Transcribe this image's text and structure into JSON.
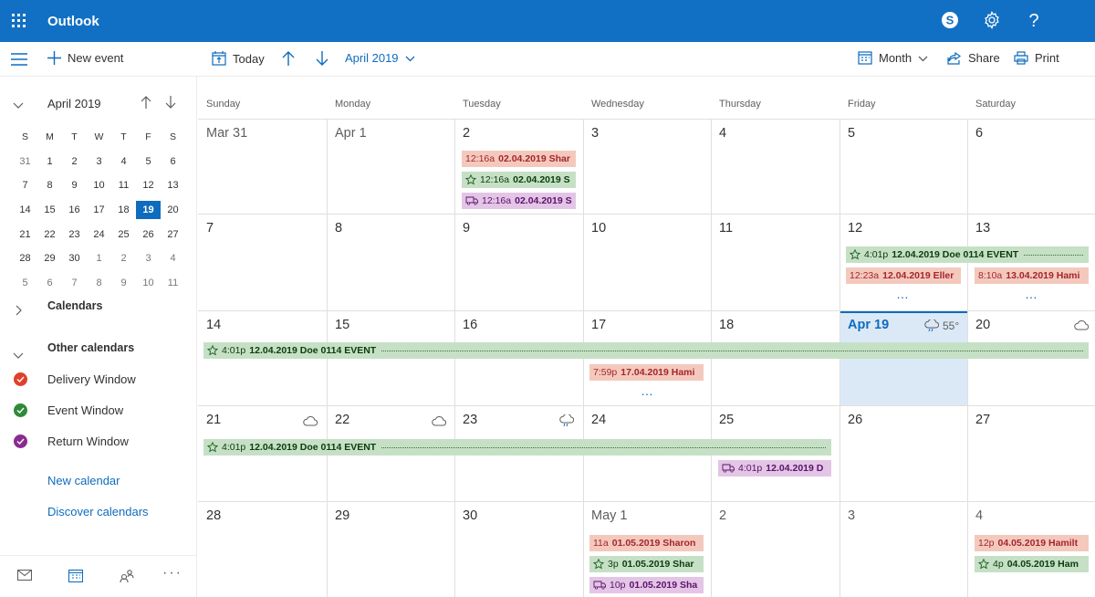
{
  "app": {
    "title": "Outlook"
  },
  "toolbar": {
    "new_event": "New event",
    "today": "Today",
    "month_label": "April 2019",
    "view": "Month",
    "share": "Share",
    "print": "Print"
  },
  "mini_calendar": {
    "title": "April 2019",
    "weekday_headers": [
      "S",
      "M",
      "T",
      "W",
      "T",
      "F",
      "S"
    ],
    "weeks": [
      [
        "31",
        "1",
        "2",
        "3",
        "4",
        "5",
        "6"
      ],
      [
        "7",
        "8",
        "9",
        "10",
        "11",
        "12",
        "13"
      ],
      [
        "14",
        "15",
        "16",
        "17",
        "18",
        "19",
        "20"
      ],
      [
        "21",
        "22",
        "23",
        "24",
        "25",
        "26",
        "27"
      ],
      [
        "28",
        "29",
        "30",
        "1",
        "2",
        "3",
        "4"
      ],
      [
        "5",
        "6",
        "7",
        "8",
        "9",
        "10",
        "11"
      ]
    ],
    "selected": "19"
  },
  "sidebar": {
    "calendars_label": "Calendars",
    "other_calendars_label": "Other calendars",
    "calendars": [
      {
        "name": "Delivery Window",
        "color": "#e0402a"
      },
      {
        "name": "Event Window",
        "color": "#2f8a3a"
      },
      {
        "name": "Return Window",
        "color": "#8a2c8f"
      }
    ],
    "new_calendar": "New calendar",
    "discover_calendars": "Discover calendars"
  },
  "calendar": {
    "weekdays": [
      "Sunday",
      "Monday",
      "Tuesday",
      "Wednesday",
      "Thursday",
      "Friday",
      "Saturday"
    ],
    "weeks": [
      [
        "Mar 31",
        "Apr 1",
        "2",
        "3",
        "4",
        "5",
        "6"
      ],
      [
        "7",
        "8",
        "9",
        "10",
        "11",
        "12",
        "13"
      ],
      [
        "14",
        "15",
        "16",
        "17",
        "18",
        "Apr 19",
        "20"
      ],
      [
        "21",
        "22",
        "23",
        "24",
        "25",
        "26",
        "27"
      ],
      [
        "28",
        "29",
        "30",
        "May 1",
        "2",
        "3",
        "4"
      ]
    ],
    "weather_today": "55°",
    "more": "…",
    "events": {
      "w0_tue_1": {
        "time": "12:16a",
        "title": "02.04.2019 Shar"
      },
      "w0_tue_2": {
        "time": "12:16a",
        "title": "02.04.2019 S"
      },
      "w0_tue_3": {
        "time": "12:16a",
        "title": "02.04.2019 S"
      },
      "w1_event": {
        "time": "4:01p",
        "title": "12.04.2019 Doe 0114 EVENT"
      },
      "w1_fri": {
        "time": "12:23a",
        "title": "12.04.2019 Eller"
      },
      "w1_sat": {
        "time": "8:10a",
        "title": "13.04.2019 Hami"
      },
      "w2_event": {
        "time": "4:01p",
        "title": "12.04.2019 Doe 0114 EVENT"
      },
      "w2_wed": {
        "time": "7:59p",
        "title": "17.04.2019 Hami"
      },
      "w3_event": {
        "time": "4:01p",
        "title": "12.04.2019 Doe 0114 EVENT"
      },
      "w3_thu": {
        "time": "4:01p",
        "title": "12.04.2019 D"
      },
      "w4_wed_1": {
        "time": "11a",
        "title": "01.05.2019 Sharon"
      },
      "w4_wed_2": {
        "time": "3p",
        "title": "01.05.2019 Shar"
      },
      "w4_wed_3": {
        "time": "10p",
        "title": "01.05.2019 Sha"
      },
      "w4_sat_1": {
        "time": "12p",
        "title": "04.05.2019 Hamilt"
      },
      "w4_sat_2": {
        "time": "4p",
        "title": "04.05.2019 Ham"
      }
    }
  },
  "colors": {
    "brand": "#1170c4",
    "delivery": "#f4c9bd",
    "event": "#c6e0c6",
    "return": "#e3c5e6"
  }
}
